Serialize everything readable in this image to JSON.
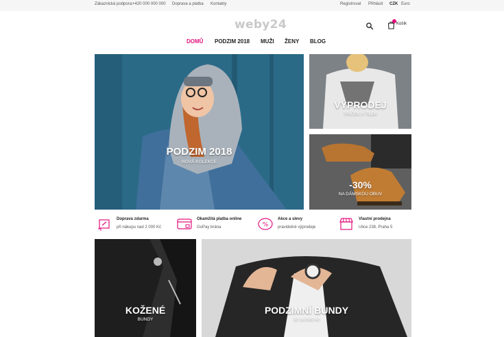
{
  "topbar": {
    "support_label": "Zákaznická podpora:",
    "support_phone": "+420 000 000 000",
    "shipping_link": "Doprava a platba",
    "contacts_link": "Kontakty",
    "register_link": "Registrovat",
    "login_link": "Přihlásit",
    "currency_czk": "CZK",
    "currency_euro": "Euro"
  },
  "header": {
    "logo": "weby24",
    "cart_label": "Košík",
    "search_icon": "search-icon",
    "cart_icon": "cart-icon"
  },
  "nav": {
    "items": [
      "DOMŮ",
      "PODZIM 2018",
      "MUŽI",
      "ŽENY",
      "BLOG"
    ],
    "active_color": "#e2107c"
  },
  "banners": {
    "main": {
      "title": "PODZIM 2018",
      "subtitle": "NOVÁ KOLEKCE"
    },
    "sale": {
      "title": "VÝPRODEJ",
      "subtitle": "TRIČEK A TÍLEK"
    },
    "shoes": {
      "title": "-30%",
      "subtitle": "NA DÁMSKOU OBUV"
    },
    "leather": {
      "title": "KOŽENÉ",
      "subtitle": "BUNDY"
    },
    "winter": {
      "title": "PODZIMNÍ BUNDY",
      "subtitle": "Již od 699 Kč"
    }
  },
  "features": [
    {
      "icon": "delivery-box-icon",
      "title": "Doprava zdarma",
      "subtitle": "při nákupu nad 2 000 Kč"
    },
    {
      "icon": "credit-card-icon",
      "title": "Okamžitá platba online",
      "subtitle": "GoPay brána"
    },
    {
      "icon": "discount-tag-icon",
      "title": "Akce a slevy",
      "subtitle": "pravidelné výprodeje"
    },
    {
      "icon": "store-icon",
      "title": "Vlastní prodejna",
      "subtitle": "Ulice 238, Praha 5"
    }
  ],
  "colors": {
    "accent": "#e2107c",
    "topbar_bg": "#f6f6f6"
  }
}
